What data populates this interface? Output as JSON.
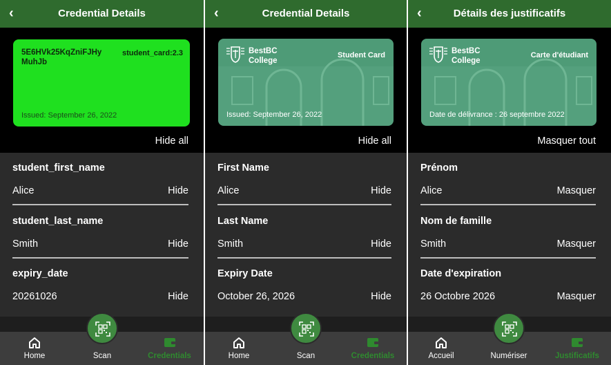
{
  "panels": [
    {
      "header": {
        "back_icon": "‹",
        "title": "Credential Details"
      },
      "card": {
        "style": "plain-green",
        "id_text": "5E6HVk25KqZniFJHyMuhJb",
        "type_label": "student_card:2.3",
        "issued": "Issued: September 26, 2022"
      },
      "hide_all": "Hide all",
      "fields": [
        {
          "name": "student_first_name",
          "value": "Alice",
          "action": "Hide"
        },
        {
          "name": "student_last_name",
          "value": "Smith",
          "action": "Hide"
        },
        {
          "name": "expiry_date",
          "value": "20261026",
          "action": "Hide"
        }
      ],
      "nav": {
        "home": "Home",
        "scan": "Scan",
        "credentials": "Credentials"
      }
    },
    {
      "header": {
        "back_icon": "‹",
        "title": "Credential Details"
      },
      "card": {
        "style": "college",
        "college_line1": "BestBC",
        "college_line2": "College",
        "type_label": "Student Card",
        "issued": "Issued: September 26, 2022"
      },
      "hide_all": "Hide all",
      "fields": [
        {
          "name": "First Name",
          "value": "Alice",
          "action": "Hide"
        },
        {
          "name": "Last Name",
          "value": "Smith",
          "action": "Hide"
        },
        {
          "name": "Expiry Date",
          "value": "October 26, 2026",
          "action": "Hide"
        }
      ],
      "nav": {
        "home": "Home",
        "scan": "Scan",
        "credentials": "Credentials"
      }
    },
    {
      "header": {
        "back_icon": "‹",
        "title": "Détails des justificatifs"
      },
      "card": {
        "style": "college",
        "college_line1": "BestBC",
        "college_line2": "College",
        "type_label": "Carte d'étudiant",
        "issued": "Date de délivrance : 26 septembre 2022"
      },
      "hide_all": "Masquer tout",
      "fields": [
        {
          "name": "Prénom",
          "value": "Alice",
          "action": "Masquer"
        },
        {
          "name": "Nom de famille",
          "value": "Smith",
          "action": "Masquer"
        },
        {
          "name": "Date d'expiration",
          "value": "26 Octobre 2026",
          "action": "Masquer"
        }
      ],
      "nav": {
        "home": "Accueil",
        "scan": "Numériser",
        "credentials": "Justificatifs"
      }
    }
  ],
  "colors": {
    "header": "#2f6b2e",
    "card_green": "#1fe01f",
    "card_college": "#4e9b77",
    "field_bg": "#2b2b2b",
    "nav_bg": "#3d3d3d",
    "nav_active": "#2f8a2f",
    "scan_button": "#3f8a40"
  },
  "icons": {
    "back": "chevron-left-icon",
    "home": "home-icon",
    "scan": "qr-code-icon",
    "credentials": "wallet-icon",
    "college_logo": "shield-book-icon"
  }
}
